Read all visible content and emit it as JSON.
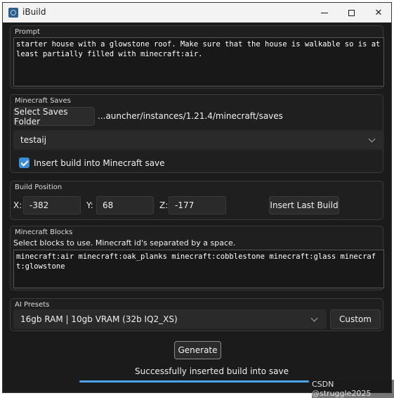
{
  "window": {
    "title": "iBuild",
    "controls": {
      "minimize": "—",
      "maximize": "☐",
      "close": "✕"
    }
  },
  "prompt": {
    "label": "Prompt",
    "value": "starter house with a glowstone roof. Make sure that the house is walkable so is at least partially filled with minecraft:air."
  },
  "saves": {
    "label": "Minecraft Saves",
    "select_button": "Select Saves Folder",
    "path": "...auncher/instances/1.21.4/minecraft/saves",
    "selected_world": "testaij",
    "insert_checkbox_label": "Insert build into Minecraft save",
    "insert_checked": true
  },
  "position": {
    "label": "Build Position",
    "x_label": "X:",
    "x_value": "-382",
    "y_label": "Y:",
    "y_value": "68",
    "z_label": "Z:",
    "z_value": "-177",
    "insert_last_button": "Insert Last Build"
  },
  "blocks": {
    "label": "Minecraft Blocks",
    "instructions": "Select blocks to use. Minecraft id's separated by a space.",
    "value": "minecraft:air minecraft:oak_planks minecraft:cobblestone minecraft:glass minecraft:glowstone"
  },
  "presets": {
    "label": "AI Presets",
    "selected": "16gb RAM | 10gb VRAM (32b IQ2_XS)",
    "custom_button": "Custom"
  },
  "actions": {
    "generate_button": "Generate",
    "status": "Successfully inserted build into save",
    "progress": 1.0
  },
  "watermark": "CSDN @struggle2025",
  "colors": {
    "accent": "#4aa3e8",
    "checkbox": "#3a8ed6",
    "background": "#1b1b1b"
  }
}
